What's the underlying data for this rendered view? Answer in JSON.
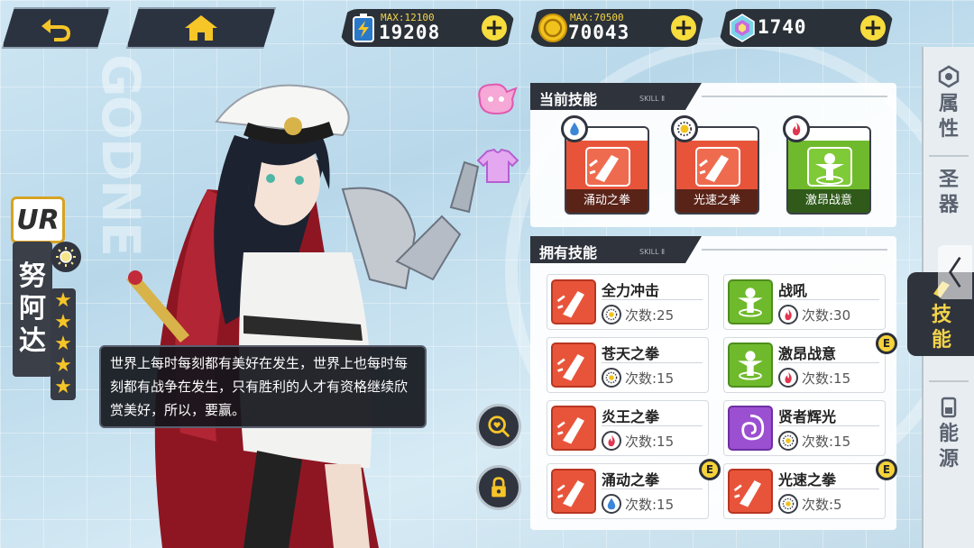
{
  "top": {
    "energy": {
      "max_label": "MAX:12100",
      "value": "19208"
    },
    "gold": {
      "max_label": "MAX:70500",
      "value": "70043"
    },
    "gems": {
      "value": "1740"
    },
    "plus_symbol": "+"
  },
  "background": {
    "watermark": "GODNE"
  },
  "character": {
    "rank": "UR",
    "name": [
      "努",
      "阿",
      "达"
    ],
    "stars": 5,
    "quote": "世界上每时每刻都有美好在发生，世界上也每时每刻都有战争在发生，只有胜利的人才有资格继续欣赏美好，所以，要赢。"
  },
  "current_skills": {
    "title": "当前技能",
    "tag": "SKILL Ⅱ",
    "items": [
      {
        "label": "涌动之拳",
        "color": "red",
        "element": "water-drop-icon"
      },
      {
        "label": "光速之拳",
        "color": "red",
        "element": "sun-icon"
      },
      {
        "label": "激昂战意",
        "color": "green",
        "element": "fire-icon"
      }
    ]
  },
  "owned_skills": {
    "title": "拥有技能",
    "tag": "SKILL Ⅱ",
    "items": [
      {
        "name": "全力冲击",
        "count": "次数:25",
        "color": "red",
        "element": "sun-icon",
        "equipped": false
      },
      {
        "name": "战吼",
        "count": "次数:30",
        "color": "green",
        "element": "fire-icon",
        "equipped": false
      },
      {
        "name": "苍天之拳",
        "count": "次数:15",
        "color": "red",
        "element": "sun-icon",
        "equipped": false
      },
      {
        "name": "激昂战意",
        "count": "次数:15",
        "color": "green",
        "element": "fire-icon",
        "equipped": true
      },
      {
        "name": "炎王之拳",
        "count": "次数:15",
        "color": "red",
        "element": "fire-icon",
        "equipped": false
      },
      {
        "name": "贤者辉光",
        "count": "次数:15",
        "color": "purple",
        "element": "sun-icon",
        "equipped": false
      },
      {
        "name": "涌动之拳",
        "count": "次数:15",
        "color": "red",
        "element": "water-drop-icon",
        "equipped": true
      },
      {
        "name": "光速之拳",
        "count": "次数:5",
        "color": "red",
        "element": "sun-icon",
        "equipped": true
      }
    ],
    "equipped_badge": "E"
  },
  "tabs": [
    {
      "label": [
        "属",
        "性"
      ],
      "active": false
    },
    {
      "label": [
        "圣",
        "器"
      ],
      "active": false
    },
    {
      "label": [
        "技",
        "能"
      ],
      "active": true
    },
    {
      "label": [
        "能",
        "源"
      ],
      "active": false
    }
  ],
  "colors": {
    "accent": "#f3d44a",
    "dark": "#2f333c",
    "skill_red": "#e8543a",
    "skill_green": "#6fba2c",
    "skill_purple": "#9b4fd1"
  }
}
